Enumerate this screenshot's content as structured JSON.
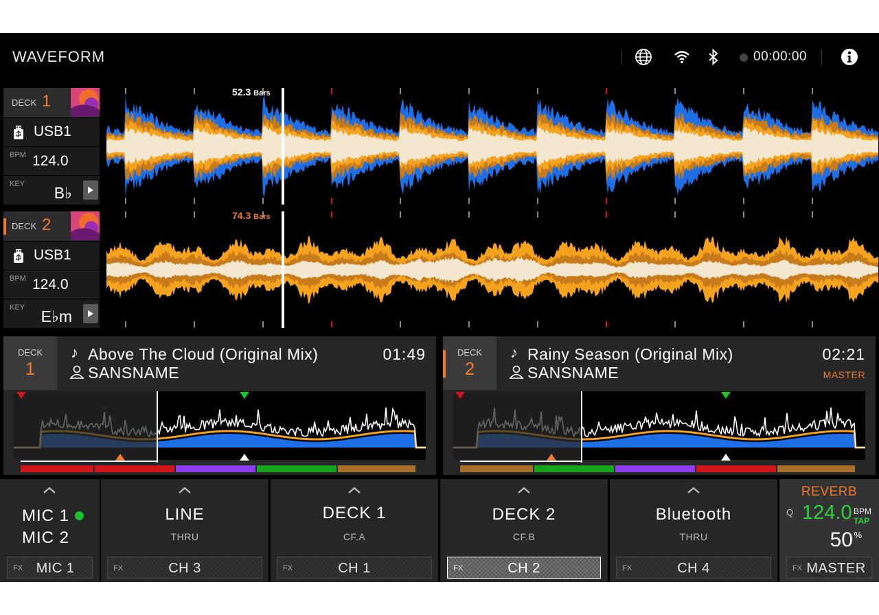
{
  "header": {
    "title": "WAVEFORM",
    "rec_time": "00:00:00",
    "icons": [
      "globe-icon",
      "wifi-icon",
      "bluetooth-icon",
      "record-dot-icon",
      "info-icon"
    ]
  },
  "decks": [
    {
      "deck_label": "DECK",
      "deck_number": "1",
      "source": "USB1",
      "bpm_label": "BPM",
      "bpm": "124.0",
      "key_label": "KEY",
      "key": "B♭",
      "bars": "52.3",
      "bars_unit": "Bars",
      "track_title": "Above The Cloud (Original Mix)",
      "artist": "SANSNAME",
      "time": "01:49",
      "status": "",
      "waveform_colors": [
        "#1e6fe6",
        "#c77b1a",
        "#f5a21f",
        "#f3e7cf"
      ],
      "hotcue_colors": [
        "#d0161a",
        "#d0161a",
        "#8f3df0",
        "#17a41f",
        "#a8702a"
      ]
    },
    {
      "deck_label": "DECK",
      "deck_number": "2",
      "source": "USB1",
      "bpm_label": "BPM",
      "bpm": "124.0",
      "key_label": "KEY",
      "key": "E♭m",
      "bars": "74.3",
      "bars_unit": "Bars",
      "track_title": "Rainy Season (Original Mix)",
      "artist": "SANSNAME",
      "time": "02:21",
      "status": "MASTER",
      "waveform_colors": [
        "#f5a21f",
        "#c77b1a",
        "#f3e7cf"
      ],
      "hotcue_colors": [
        "#a8702a",
        "#17a41f",
        "#8f3df0",
        "#d0161a",
        "#a8702a"
      ]
    }
  ],
  "channels": [
    {
      "name_lines": [
        "MIC 1",
        "MIC 2"
      ],
      "sub": "",
      "fx_tag": "FX",
      "fx_value": "MIC 1",
      "selected": false
    },
    {
      "name": "LINE",
      "sub": "THRU",
      "fx_tag": "FX",
      "fx_value": "CH 3",
      "selected": false
    },
    {
      "name": "DECK 1",
      "sub": "CF.A",
      "fx_tag": "FX",
      "fx_value": "CH 1",
      "selected": false
    },
    {
      "name": "DECK 2",
      "sub": "CF.B",
      "fx_tag": "FX",
      "fx_value": "CH 2",
      "selected": true
    },
    {
      "name": "Bluetooth",
      "sub": "THRU",
      "fx_tag": "FX",
      "fx_value": "CH 4",
      "selected": false
    }
  ],
  "fx_panel": {
    "effect": "REVERB",
    "q_label": "Q",
    "bpm": "124.0",
    "bpm_label": "BPM",
    "tap_label": "TAP",
    "level": "50",
    "level_unit": "%",
    "fx_tag": "FX",
    "fx_value": "MASTER"
  },
  "colors": {
    "accent_orange": "#f07a2a",
    "active_green": "#1bbf2a",
    "cue_red": "#d0161a",
    "cue_green": "#17c81f"
  }
}
